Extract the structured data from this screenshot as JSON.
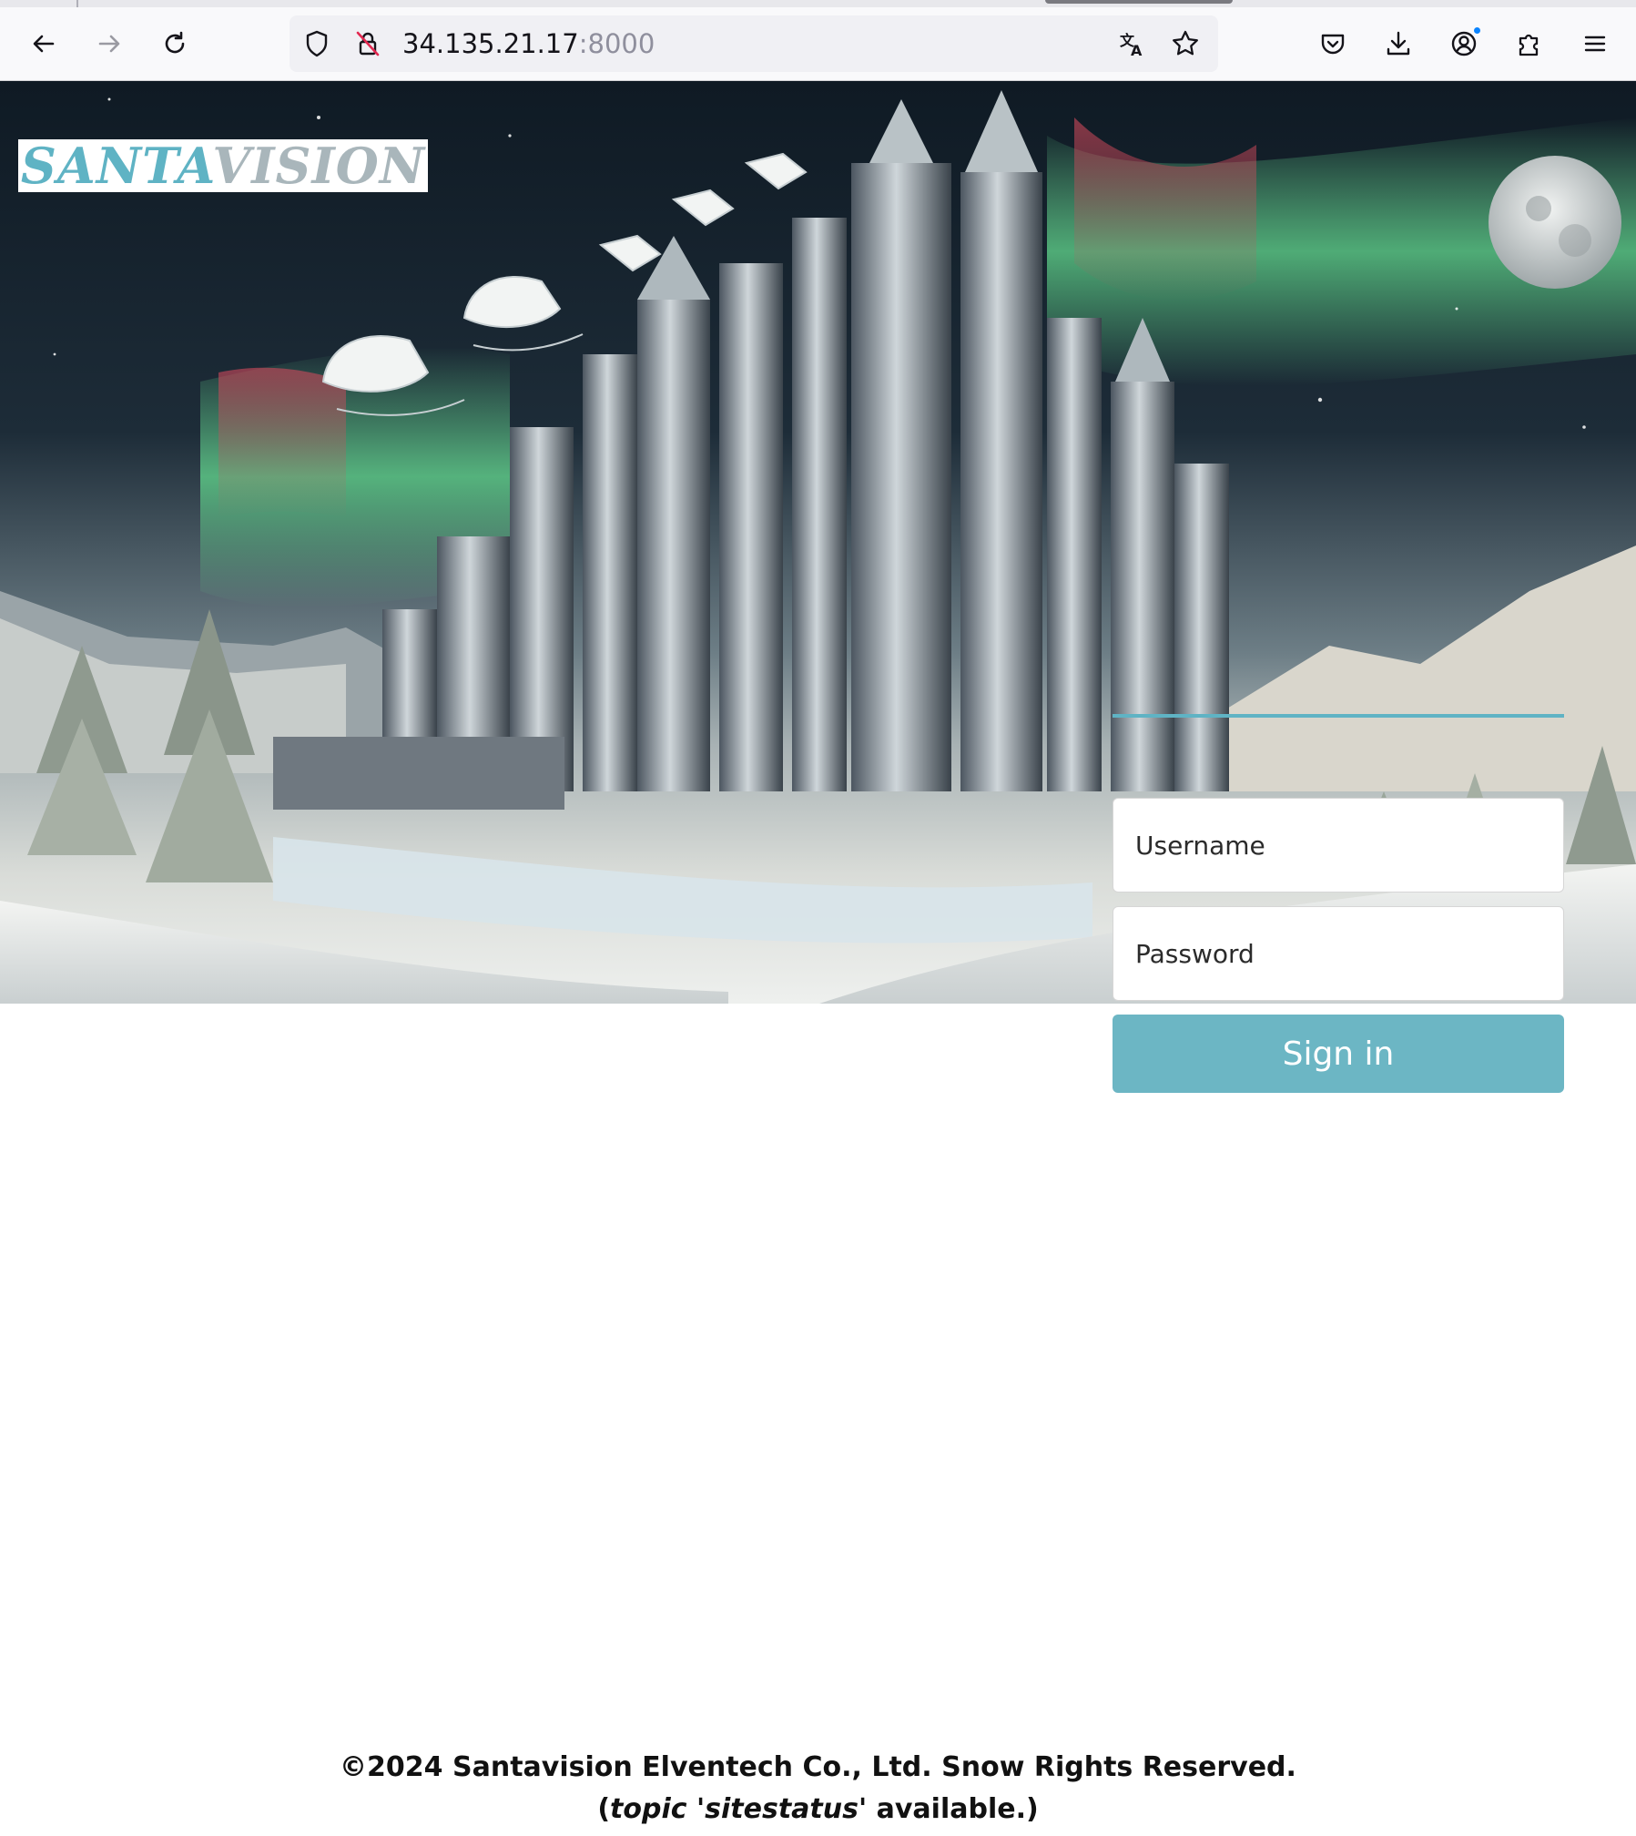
{
  "browser": {
    "address": {
      "host": "34.135.21.17",
      "port": ":8000"
    },
    "icons": {
      "back": "back-arrow-icon",
      "forward": "forward-arrow-icon",
      "reload": "reload-icon",
      "tracking": "shield-icon",
      "insecure": "insecure-lock-icon",
      "translate": "translate-icon",
      "bookmark": "star-icon",
      "pocket": "pocket-icon",
      "downloads": "download-icon",
      "account": "account-icon",
      "extensions": "puzzle-icon",
      "menu": "hamburger-menu-icon"
    }
  },
  "brand": {
    "logo_part1": "SANTA",
    "logo_part2": "VISION",
    "accent_color": "#5fb3c4",
    "button_color": "#6cb6c4"
  },
  "login": {
    "username_placeholder": "Username",
    "password_placeholder": "Password",
    "submit_label": "Sign in"
  },
  "footer": {
    "copyright": "©2024 Santavision Elventech Co., Ltd. Snow Rights Reserved.",
    "topic_prefix": "(",
    "topic_italic": "topic 'sitestatus'",
    "topic_suffix": " available.)"
  }
}
